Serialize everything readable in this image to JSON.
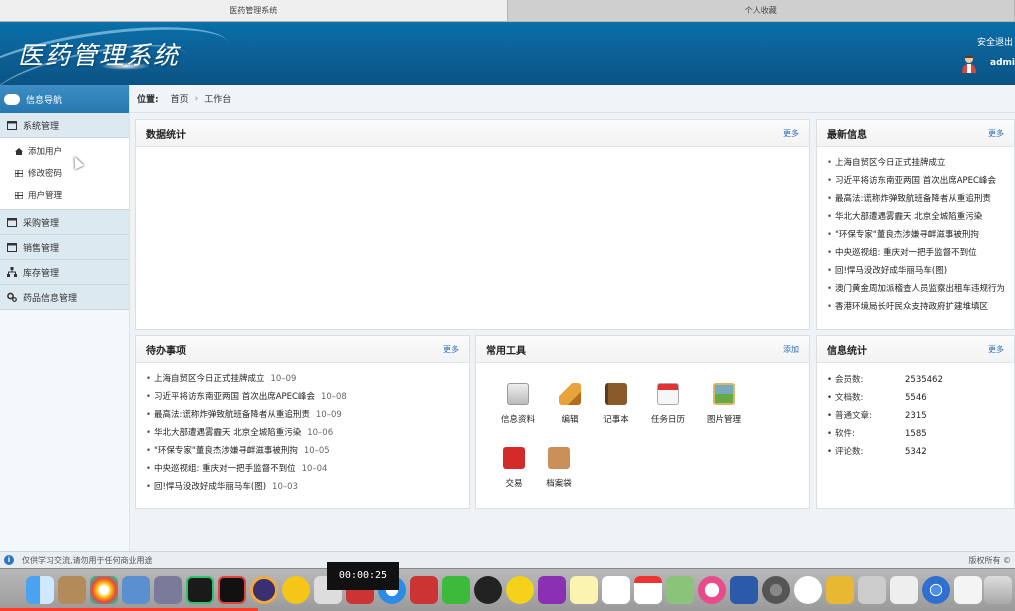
{
  "tabs": [
    {
      "label": "医药管理系统",
      "active": true
    },
    {
      "label": "个人收藏",
      "active": false
    }
  ],
  "header": {
    "title": "医药管理系统",
    "logout": "安全退出",
    "user": "admin"
  },
  "sidebar": {
    "nav_title": "信息导航",
    "groups": [
      {
        "label": "系统管理",
        "icon": "calendar-icon",
        "items": [
          {
            "label": "添加用户",
            "icon": "home-icon"
          },
          {
            "label": "修改密码",
            "icon": "list-icon"
          },
          {
            "label": "用户管理",
            "icon": "list-icon"
          }
        ]
      },
      {
        "label": "采购管理",
        "icon": "calendar-icon"
      },
      {
        "label": "销售管理",
        "icon": "calendar-icon"
      },
      {
        "label": "库存管理",
        "icon": "tree-icon"
      },
      {
        "label": "药品信息管理",
        "icon": "gears-icon"
      }
    ]
  },
  "breadcrumb": {
    "prefix": "位置:",
    "items": [
      "首页",
      "工作台"
    ],
    "separator": "›"
  },
  "panels": {
    "stats_chart": {
      "title": "数据统计",
      "more": "更多"
    },
    "news": {
      "title": "最新信息",
      "more": "更多",
      "items": [
        "上海自贸区今日正式挂牌成立",
        "习近平将访东南亚两国 首次出席APEC峰会",
        "最高法:谎称炸弹致航班备降者从重追刑责",
        "华北大部遭遇雾霾天 北京全城陷重污染",
        "\"环保专家\"董良杰涉嫌寻衅滋事被刑拘",
        "中央巡视组: 重庆对一把手监督不到位",
        "回!悍马没改好成华丽马车(图)",
        "澳门黄金周加派稽查人员监察出租车违规行为",
        "香港环境局长吁民众支持政府扩建堆填区"
      ]
    },
    "todo": {
      "title": "待办事项",
      "more": "更多",
      "items": [
        {
          "text": "上海自贸区今日正式挂牌成立",
          "date": "10–09"
        },
        {
          "text": "习近平将访东南亚两国 首次出席APEC峰会",
          "date": "10–08"
        },
        {
          "text": "最高法:谎称炸弹致航班备降者从重追刑责",
          "date": "10–09"
        },
        {
          "text": "华北大部遭遇雾霾天 北京全城陷重污染",
          "date": "10–06"
        },
        {
          "text": "\"环保专家\"董良杰涉嫌寻衅滋事被刑拘",
          "date": "10–05"
        },
        {
          "text": "中央巡视组: 重庆对一把手监督不到位",
          "date": "10–04"
        },
        {
          "text": "回!悍马没改好成华丽马车(图)",
          "date": "10–03"
        }
      ]
    },
    "tools": {
      "title": "常用工具",
      "more": "添加",
      "items": [
        {
          "label": "信息资料",
          "icon": "drive-icon",
          "color": "#c9c9c9"
        },
        {
          "label": "编辑",
          "icon": "pencil-icon",
          "color": "#e2a63a"
        },
        {
          "label": "记事本",
          "icon": "notebook-icon",
          "color": "#8b5a2b"
        },
        {
          "label": "任务日历",
          "icon": "calendar-icon",
          "color": "#e9e9e9"
        },
        {
          "label": "图片管理",
          "icon": "picture-icon",
          "color": "#d9b56a"
        },
        {
          "label": "交易",
          "icon": "bag-icon",
          "color": "#d42a2a"
        },
        {
          "label": "档案袋",
          "icon": "folder-icon",
          "color": "#c9905a"
        }
      ]
    },
    "info_stats": {
      "title": "信息统计",
      "more": "更多",
      "rows": [
        {
          "key": "会员数:",
          "value": "2535462"
        },
        {
          "key": "文档数:",
          "value": "5546"
        },
        {
          "key": "普通文章:",
          "value": "2315"
        },
        {
          "key": "软件:",
          "value": "1585"
        },
        {
          "key": "评论数:",
          "value": "5342"
        }
      ]
    }
  },
  "status_bar": {
    "left": "仅供学习交流,请勿用于任何商业用途",
    "right": "版权所有 ©"
  },
  "video": {
    "time": "00:00:25",
    "progress": 0.254
  },
  "colors": {
    "header_blue": "#0c5f95",
    "link_blue": "#2a6ebd",
    "sidebar_head": "#2878b0"
  }
}
